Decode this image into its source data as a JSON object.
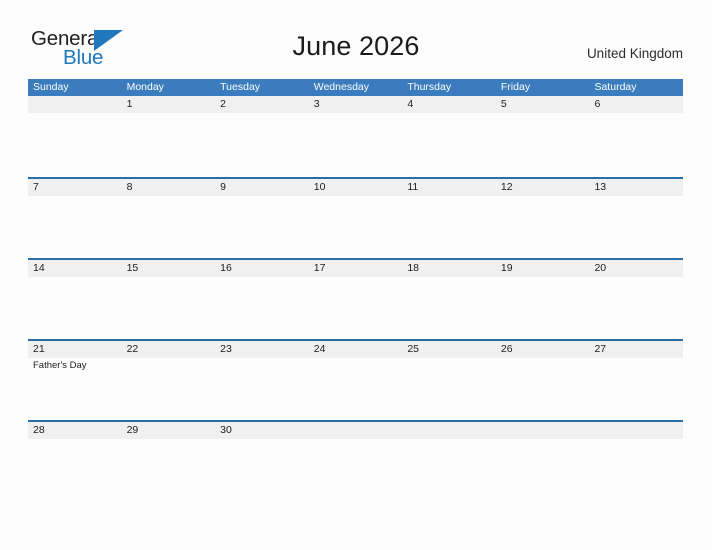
{
  "brand": {
    "name_part1": "General",
    "name_part2": "Blue",
    "mark_icon": "blue-triangle-flag-icon",
    "color_dark": "#231f20",
    "color_blue": "#2077bc"
  },
  "header": {
    "title": "June 2026",
    "country": "United Kingdom"
  },
  "theme": {
    "header_blue": "#3a7cbd",
    "row_rule_blue": "#2e6da4",
    "band_gray": "#f0f0f0",
    "page_background": "#fdfdfd",
    "text_dark": "#1d1d1d"
  },
  "calendar": {
    "month": "June",
    "year": "2026",
    "weekdays": [
      "Sunday",
      "Monday",
      "Tuesday",
      "Wednesday",
      "Thursday",
      "Friday",
      "Saturday"
    ],
    "weeks": [
      {
        "days": [
          {
            "number": "",
            "events": []
          },
          {
            "number": "1",
            "events": []
          },
          {
            "number": "2",
            "events": []
          },
          {
            "number": "3",
            "events": []
          },
          {
            "number": "4",
            "events": []
          },
          {
            "number": "5",
            "events": []
          },
          {
            "number": "6",
            "events": []
          }
        ]
      },
      {
        "days": [
          {
            "number": "7",
            "events": []
          },
          {
            "number": "8",
            "events": []
          },
          {
            "number": "9",
            "events": []
          },
          {
            "number": "10",
            "events": []
          },
          {
            "number": "11",
            "events": []
          },
          {
            "number": "12",
            "events": []
          },
          {
            "number": "13",
            "events": []
          }
        ]
      },
      {
        "days": [
          {
            "number": "14",
            "events": []
          },
          {
            "number": "15",
            "events": []
          },
          {
            "number": "16",
            "events": []
          },
          {
            "number": "17",
            "events": []
          },
          {
            "number": "18",
            "events": []
          },
          {
            "number": "19",
            "events": []
          },
          {
            "number": "20",
            "events": []
          }
        ]
      },
      {
        "days": [
          {
            "number": "21",
            "events": [
              "Father's Day"
            ]
          },
          {
            "number": "22",
            "events": []
          },
          {
            "number": "23",
            "events": []
          },
          {
            "number": "24",
            "events": []
          },
          {
            "number": "25",
            "events": []
          },
          {
            "number": "26",
            "events": []
          },
          {
            "number": "27",
            "events": []
          }
        ]
      },
      {
        "days": [
          {
            "number": "28",
            "events": []
          },
          {
            "number": "29",
            "events": []
          },
          {
            "number": "30",
            "events": []
          },
          {
            "number": "",
            "events": []
          },
          {
            "number": "",
            "events": []
          },
          {
            "number": "",
            "events": []
          },
          {
            "number": "",
            "events": []
          }
        ]
      }
    ]
  }
}
